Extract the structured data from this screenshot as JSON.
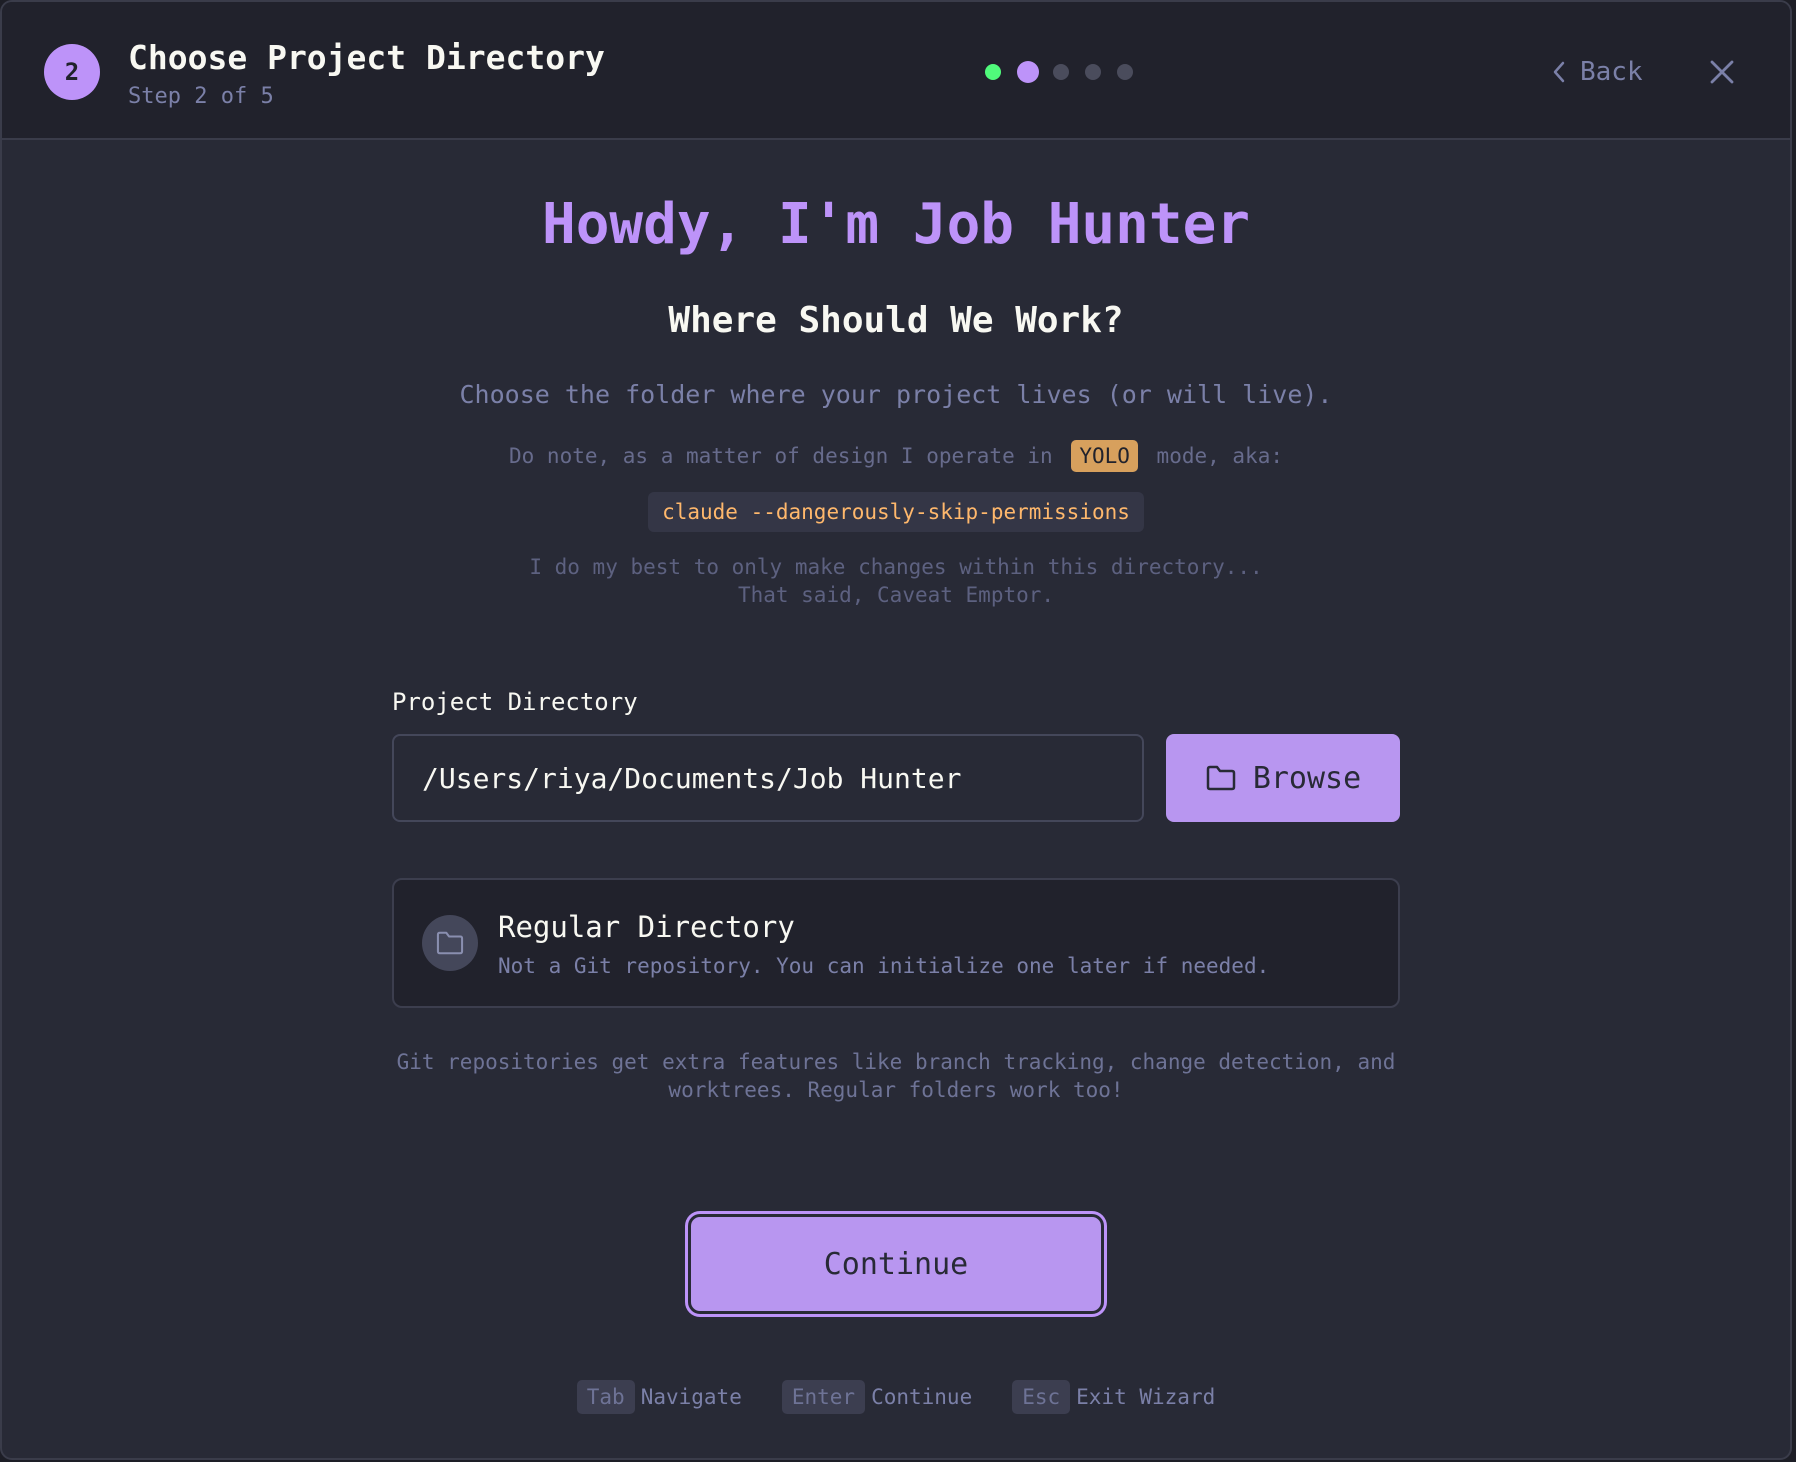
{
  "header": {
    "step_number": "2",
    "title": "Choose Project Directory",
    "subtitle": "Step 2 of 5",
    "progress": {
      "total_steps": 5,
      "completed": 1,
      "current": 2
    },
    "back_label": "Back",
    "close_icon": "close-icon"
  },
  "intro": {
    "hero": "Howdy, I'm Job Hunter",
    "heading": "Where Should We Work?",
    "description": "Choose the folder where your project lives (or will live).",
    "note_before": "Do note, as a matter of design I operate in",
    "note_badge": "YOLO",
    "note_after": "mode, aka:",
    "command": "claude --dangerously-skip-permissions",
    "caveat_line1": "I do my best to only make changes within this directory...",
    "caveat_line2": "That said, Caveat Emptor."
  },
  "directory": {
    "label": "Project Directory",
    "value": "/Users/riya/Documents/Job Hunter",
    "browse_label": "Browse",
    "browse_icon": "folder-icon"
  },
  "status_card": {
    "icon": "folder-icon",
    "title": "Regular Directory",
    "description": "Not a Git repository. You can initialize one later if needed."
  },
  "git_note": {
    "line1": "Git repositories get extra features like branch tracking, change detection, and",
    "line2": "worktrees. Regular folders work too!"
  },
  "continue_label": "Continue",
  "shortcuts": [
    {
      "key": "Tab",
      "action": "Navigate"
    },
    {
      "key": "Enter",
      "action": "Continue"
    },
    {
      "key": "Esc",
      "action": "Exit Wizard"
    }
  ],
  "colors": {
    "accent": "#bd93f9",
    "success": "#50fa7b",
    "warning": "#ffb86c",
    "background": "#282a36"
  }
}
